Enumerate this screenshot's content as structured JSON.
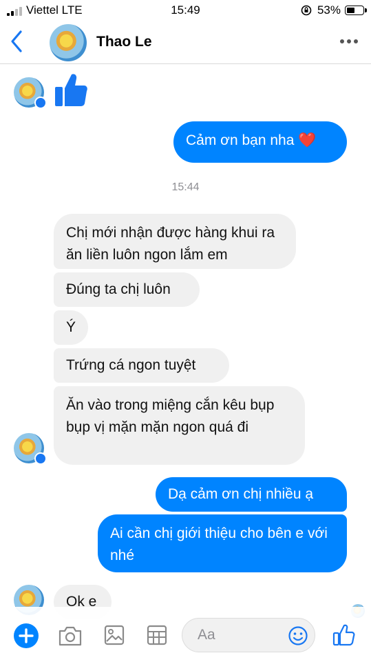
{
  "status_bar": {
    "carrier": "Viettel LTE",
    "time": "15:49",
    "battery": "53%",
    "battery_level": 0.53,
    "signal_bars": 2
  },
  "header": {
    "contact_name": "Thao Le",
    "back_icon": "chevron-left-icon",
    "more_icon": "ellipsis-icon"
  },
  "messages": {
    "out_1": "Cảm ơn bạn nha",
    "out_1_emoji": "❤️",
    "timestamp": "15:44",
    "in_1": "Chị mới nhận được hàng khui ra ăn liền luôn ngon lắm em",
    "in_2": "Đúng ta chị luôn",
    "in_3": "Ý",
    "in_4": "Trứng cá ngon tuyệt",
    "in_5": "Ăn vào trong miệng cắn kêu bụp bụp vị mặn mặn ngon quá đi",
    "out_2": "Dạ cảm ơn chị nhiều ạ",
    "out_3": "Ai cần chị giới thiệu cho bên e với nhé",
    "in_6": "Ok e"
  },
  "composer": {
    "placeholder": "Aa",
    "icons": [
      "plus-icon",
      "camera-icon",
      "gallery-icon",
      "sticker-icon",
      "emoji-icon",
      "thumbs-up-icon"
    ]
  },
  "colors": {
    "accent": "#0084ff",
    "incoming_bubble": "#f0f0f0",
    "timestamp": "#8e8e93"
  }
}
